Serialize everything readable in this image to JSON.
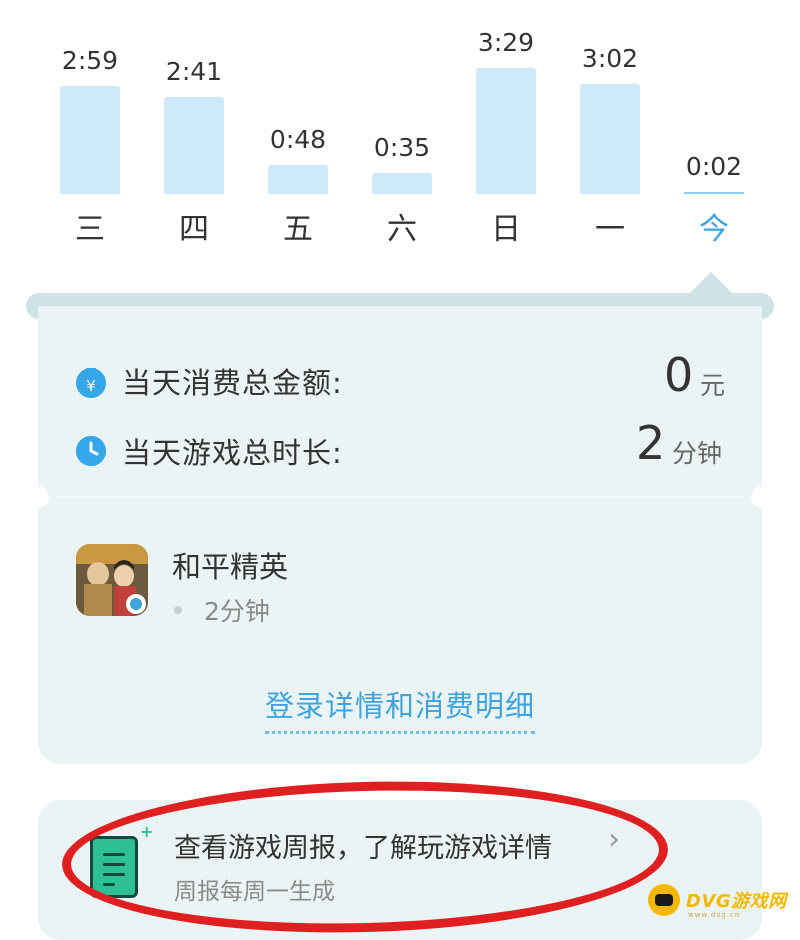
{
  "chart_data": {
    "type": "bar",
    "categories": [
      "三",
      "四",
      "五",
      "六",
      "日",
      "一",
      "今"
    ],
    "labels": [
      "2:59",
      "2:41",
      "0:48",
      "0:35",
      "3:29",
      "3:02",
      "0:02"
    ],
    "values": [
      179,
      161,
      48,
      35,
      209,
      182,
      2
    ],
    "value_units": "minutes",
    "selected_index": 6,
    "colors": {
      "bar": "#cde9fa",
      "selected_label": "#3fa4dd"
    }
  },
  "summary": {
    "spend_label": "当天消费总金额:",
    "spend_value": "0",
    "spend_unit": "元",
    "spend_icon": "money-bag-icon",
    "time_label": "当天游戏总时长:",
    "time_value": "2",
    "time_unit": "分钟",
    "time_icon": "clock-icon"
  },
  "game": {
    "name": "和平精英",
    "duration": "2分钟",
    "icon": "game-cover-icon"
  },
  "detail_link": "登录详情和消费明细",
  "weekly_report": {
    "title": "查看游戏周报，了解玩游戏详情",
    "subtitle": "周报每周一生成",
    "chevron": "›",
    "icon": "report-document-icon"
  },
  "watermark": {
    "text": "DVG游戏网",
    "sub": "www.dvg.cn"
  },
  "colors": {
    "accent": "#3fa4dd",
    "card_background": "#eaf4f5",
    "annotation": "#e02020"
  }
}
